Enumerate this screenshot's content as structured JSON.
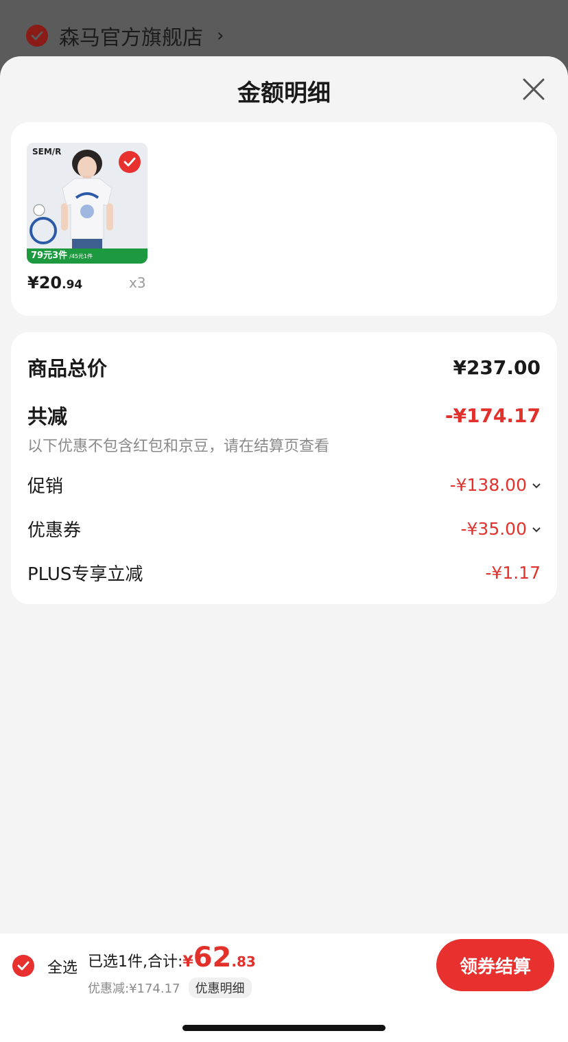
{
  "store": {
    "name": "森马官方旗舰店"
  },
  "sheet": {
    "title": "金额明细"
  },
  "product": {
    "brand": "SEM/R",
    "promo": "79元3件",
    "promo_sub": "/45元1件",
    "price_int": "¥20",
    "price_dec": ".94",
    "quantity": "x3"
  },
  "summary": {
    "total_label": "商品总价",
    "total_value": "¥237.00",
    "reduce_label": "共减",
    "reduce_value": "-¥174.17",
    "note": "以下优惠不包含红包和京豆，请在结算页查看",
    "items": [
      {
        "label": "促销",
        "value": "-¥138.00",
        "expandable": true
      },
      {
        "label": "优惠券",
        "value": "-¥35.00",
        "expandable": true
      },
      {
        "label": "PLUS专享立减",
        "value": "-¥1.17",
        "expandable": false
      }
    ]
  },
  "bottom": {
    "select_all": "全选",
    "selected_text": "已选1件,合计:",
    "total_symbol": "¥",
    "total_int": "62",
    "total_dec": ".83",
    "discount_text": "优惠减:¥174.17",
    "detail_label": "优惠明细",
    "checkout_label": "领券结算"
  },
  "colors": {
    "accent": "#e8302e",
    "promo_green": "#1d9a40"
  },
  "icons": [
    "check-icon",
    "chevron-right-icon",
    "close-icon",
    "chevron-down-icon"
  ]
}
